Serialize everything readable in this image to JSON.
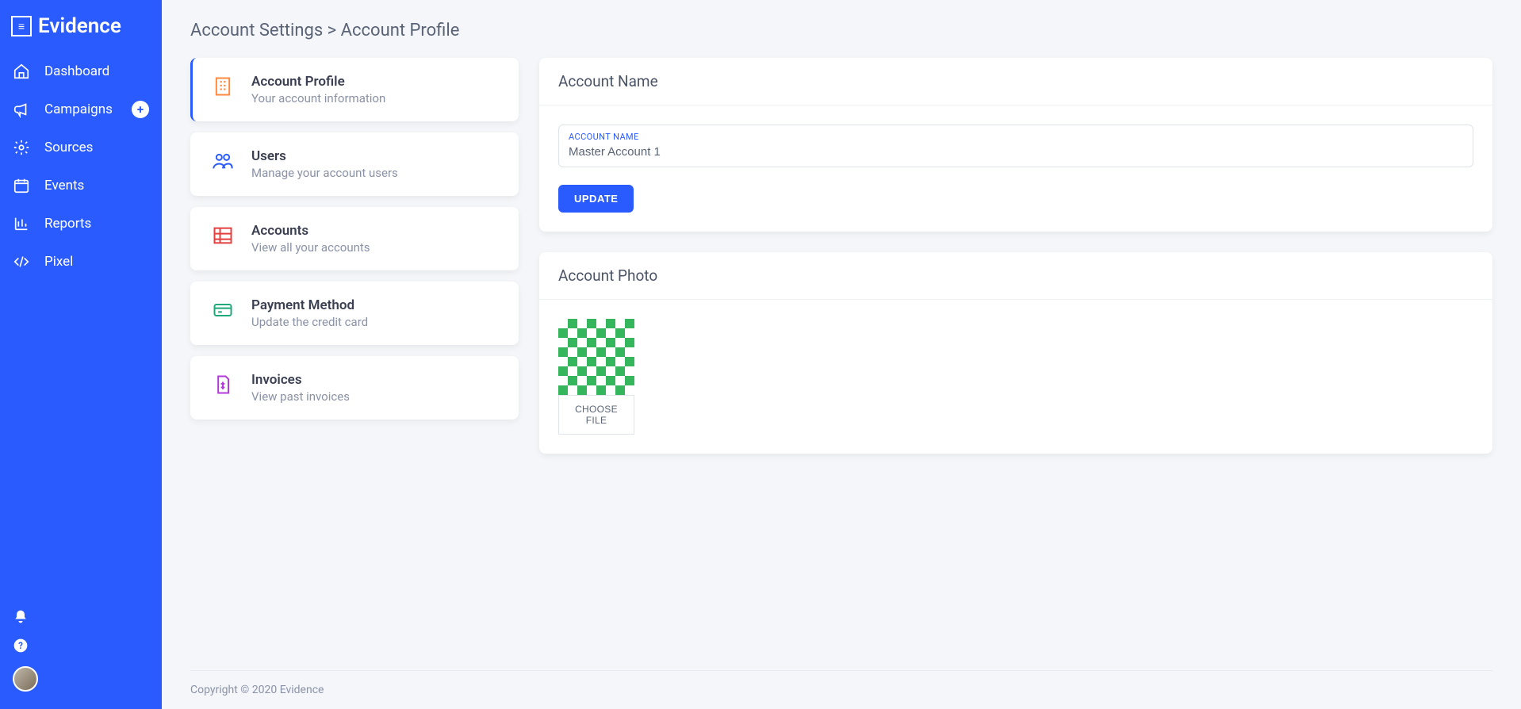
{
  "app_name": "Evidence",
  "sidebar": {
    "items": [
      {
        "label": "Dashboard"
      },
      {
        "label": "Campaigns"
      },
      {
        "label": "Sources"
      },
      {
        "label": "Events"
      },
      {
        "label": "Reports"
      },
      {
        "label": "Pixel"
      }
    ]
  },
  "breadcrumb": {
    "parent": "Account Settings",
    "separator": ">",
    "current": "Account Profile"
  },
  "settings_tiles": [
    {
      "title": "Account Profile",
      "subtitle": "Your account information"
    },
    {
      "title": "Users",
      "subtitle": "Manage your account users"
    },
    {
      "title": "Accounts",
      "subtitle": "View all your accounts"
    },
    {
      "title": "Payment Method",
      "subtitle": "Update the credit card"
    },
    {
      "title": "Invoices",
      "subtitle": "View past invoices"
    }
  ],
  "account_name_card": {
    "header": "Account Name",
    "field_label": "ACCOUNT NAME",
    "field_value": "Master Account 1",
    "button": "UPDATE"
  },
  "account_photo_card": {
    "header": "Account Photo",
    "choose_button": "CHOOSE FILE"
  },
  "footer": "Copyright © 2020 Evidence"
}
